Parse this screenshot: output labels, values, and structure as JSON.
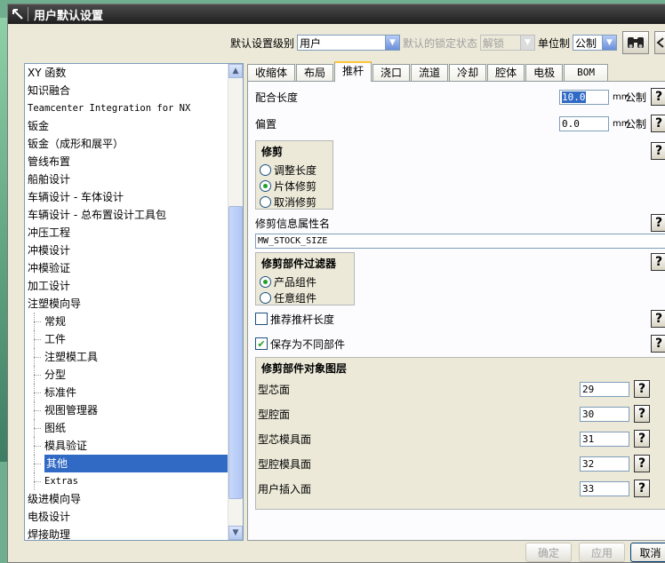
{
  "window": {
    "title": "用户默认设置"
  },
  "topbar": {
    "level_label": "默认设置级别",
    "level_value": "用户",
    "lock_label": "默认的锁定状态",
    "lock_value": "解锁",
    "unit_label": "单位制",
    "unit_value": "公制"
  },
  "tree": {
    "items": [
      {
        "label": "XY 函数"
      },
      {
        "label": "知识融合"
      },
      {
        "label": "Teamcenter Integration for NX"
      },
      {
        "label": "钣金"
      },
      {
        "label": "钣金（成形和展平）"
      },
      {
        "label": "管线布置"
      },
      {
        "label": "船舶设计"
      },
      {
        "label": "车辆设计 - 车体设计"
      },
      {
        "label": "车辆设计 - 总布置设计工具包"
      },
      {
        "label": "冲压工程"
      },
      {
        "label": "冲模设计"
      },
      {
        "label": "冲模验证"
      },
      {
        "label": "加工设计"
      },
      {
        "label": "注塑模向导"
      },
      {
        "label": "常规"
      },
      {
        "label": "工件"
      },
      {
        "label": "注塑模工具"
      },
      {
        "label": "分型"
      },
      {
        "label": "标准件"
      },
      {
        "label": "视图管理器"
      },
      {
        "label": "图纸"
      },
      {
        "label": "模具验证"
      },
      {
        "label": "其他"
      },
      {
        "label": "Extras"
      },
      {
        "label": "级进模向导"
      },
      {
        "label": "电极设计"
      },
      {
        "label": "焊接助理"
      }
    ]
  },
  "tabs": [
    "收缩体",
    "布局",
    "推杆",
    "浇口",
    "流道",
    "冷却",
    "腔体",
    "电极",
    "BOM"
  ],
  "active_tab": "推杆",
  "panel": {
    "fit_length_label": "配合长度",
    "fit_length_value": "10.0",
    "offset_label": "偏置",
    "offset_value": "0.0",
    "unit_mm": "mm",
    "unit_metric": "公制",
    "trim_group_title": "修剪",
    "trim_options": [
      "调整长度",
      "片体修剪",
      "取消修剪"
    ],
    "trim_selected": "片体修剪",
    "trim_attr_label": "修剪信息属性名",
    "trim_attr_value": "MW_STOCK_SIZE",
    "filter_group_title": "修剪部件过滤器",
    "filter_options": [
      "产品组件",
      "任意组件"
    ],
    "filter_selected": "产品组件",
    "recommend_label": "推荐推杆长度",
    "recommend_checked": false,
    "save_diff_label": "保存为不同部件",
    "save_diff_checked": true,
    "layers_title": "修剪部件对象图层",
    "layers": [
      {
        "label": "型芯面",
        "value": "29"
      },
      {
        "label": "型腔面",
        "value": "30"
      },
      {
        "label": "型芯模具面",
        "value": "31"
      },
      {
        "label": "型腔模具面",
        "value": "32"
      },
      {
        "label": "用户插入面",
        "value": "33"
      }
    ],
    "help_glyph": "?"
  },
  "footer": {
    "ok": "确定",
    "apply": "应用",
    "cancel": "取消"
  }
}
